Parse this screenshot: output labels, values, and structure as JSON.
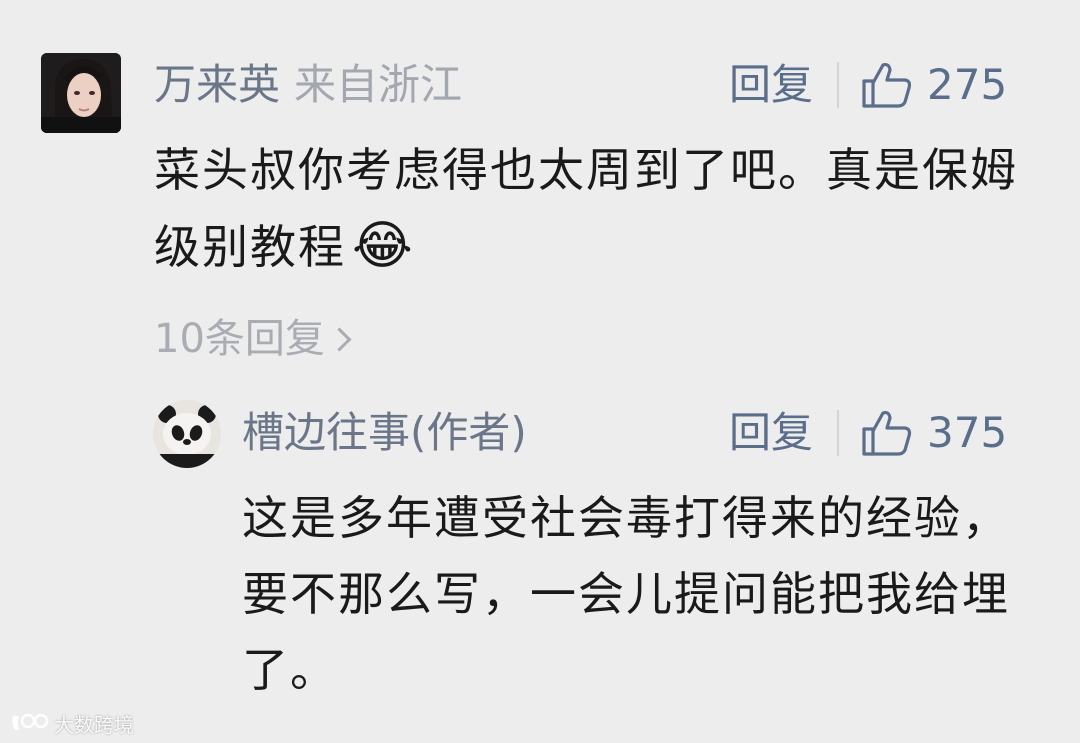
{
  "comments": [
    {
      "author": "万来英",
      "location": "来自浙江",
      "reply_label": "回复",
      "likes": "275",
      "text": "菜头叔你考虑得也太周到了吧。真是保姆级别教程",
      "emoji": "😂",
      "avatar_icon": "user-avatar-photo",
      "more_replies": "10条回复"
    }
  ],
  "reply": {
    "author": "槽边往事(作者)",
    "reply_label": "回复",
    "likes": "375",
    "text": "这是多年遭受社会毒打得来的经验，要不那么写，一会儿提问能把我给埋了。",
    "avatar_icon": "panda-avatar"
  },
  "watermark": {
    "text": "大数跨境"
  },
  "colors": {
    "background": "#ededed",
    "name": "#6b7789",
    "action": "#5a6e8c",
    "body": "#1a1a1a",
    "muted": "#a9adb3"
  }
}
